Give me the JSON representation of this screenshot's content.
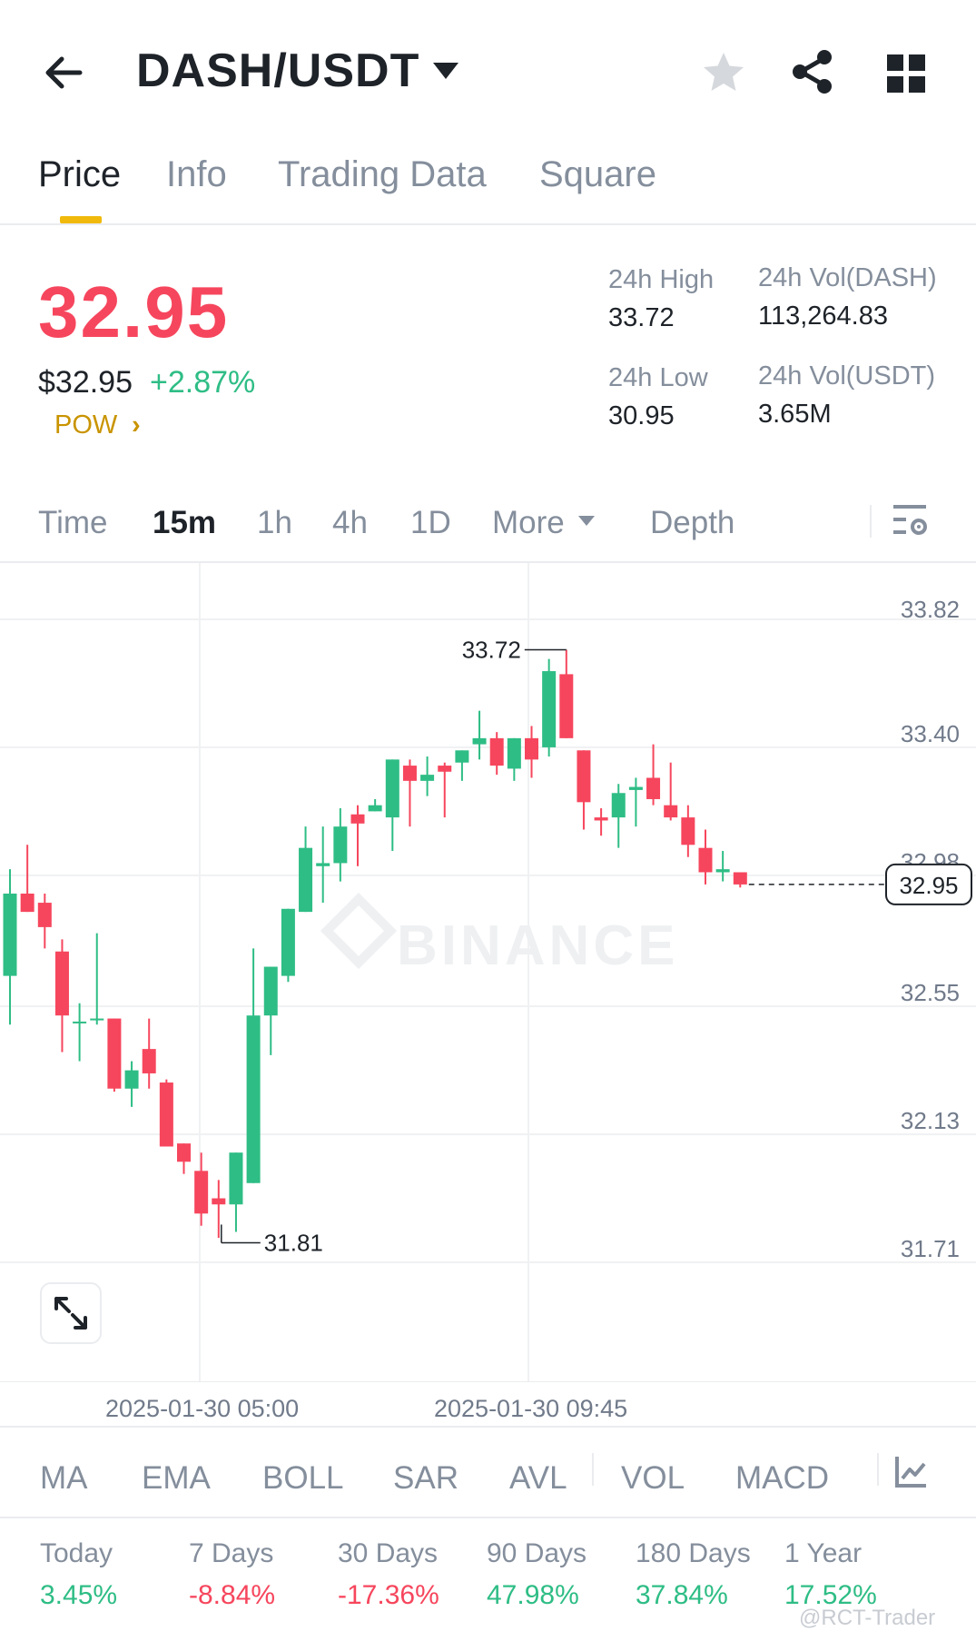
{
  "header": {
    "pair": "DASH/USDT",
    "icons": [
      "back-arrow-icon",
      "caret-down-icon",
      "star-icon",
      "share-icon",
      "grid-menu-icon"
    ]
  },
  "tabs": [
    {
      "label": "Price",
      "active": true
    },
    {
      "label": "Info",
      "active": false
    },
    {
      "label": "Trading Data",
      "active": false
    },
    {
      "label": "Square",
      "active": false
    }
  ],
  "price": {
    "last": "32.95",
    "usd": "$32.95",
    "change": "+2.87%",
    "tag": "POW",
    "tag_arrow": "›"
  },
  "stats": {
    "high_label": "24h High",
    "high_value": "33.72",
    "low_label": "24h Low",
    "low_value": "30.95",
    "vol_base_label": "24h Vol(DASH)",
    "vol_base_value": "113,264.83",
    "vol_quote_label": "24h Vol(USDT)",
    "vol_quote_value": "3.65M"
  },
  "intervals": {
    "time": "Time",
    "m15": "15m",
    "h1": "1h",
    "h4": "4h",
    "d1": "1D",
    "more": "More",
    "depth": "Depth",
    "active": "15m"
  },
  "colors": {
    "up": "#2ebd85",
    "down": "#f6465d",
    "accent": "#f0b90b",
    "text": "#1e2329",
    "muted": "#848e9c"
  },
  "chart_data": {
    "type": "candlestick",
    "ylim": [
      31.71,
      33.82
    ],
    "y_ticks": [
      "33.82",
      "33.40",
      "32.98",
      "32.55",
      "32.13",
      "31.71"
    ],
    "x_ticks": [
      "2025-01-30 05:00",
      "2025-01-30 09:45"
    ],
    "high_marker": "33.72",
    "low_marker": "31.81",
    "last_price": "32.95",
    "watermark": "BINANCE",
    "candles": [
      {
        "o": 32.65,
        "h": 33.0,
        "l": 32.49,
        "c": 32.92
      },
      {
        "o": 32.92,
        "h": 33.08,
        "l": 32.87,
        "c": 32.86
      },
      {
        "o": 32.89,
        "h": 32.92,
        "l": 32.74,
        "c": 32.81
      },
      {
        "o": 32.73,
        "h": 32.77,
        "l": 32.4,
        "c": 32.52
      },
      {
        "o": 32.5,
        "h": 32.56,
        "l": 32.37,
        "c": 32.5
      },
      {
        "o": 32.51,
        "h": 32.79,
        "l": 32.49,
        "c": 32.51
      },
      {
        "o": 32.51,
        "h": 32.51,
        "l": 32.27,
        "c": 32.28
      },
      {
        "o": 32.28,
        "h": 32.37,
        "l": 32.22,
        "c": 32.34
      },
      {
        "o": 32.41,
        "h": 32.51,
        "l": 32.28,
        "c": 32.33
      },
      {
        "o": 32.3,
        "h": 32.31,
        "l": 32.09,
        "c": 32.09
      },
      {
        "o": 32.1,
        "h": 32.08,
        "l": 32.0,
        "c": 32.04
      },
      {
        "o": 32.01,
        "h": 32.07,
        "l": 31.83,
        "c": 31.87
      },
      {
        "o": 31.92,
        "h": 31.98,
        "l": 31.79,
        "c": 31.9
      },
      {
        "o": 31.9,
        "h": 32.05,
        "l": 31.81,
        "c": 32.07
      },
      {
        "o": 31.97,
        "h": 32.74,
        "l": 31.97,
        "c": 32.52
      },
      {
        "o": 32.52,
        "h": 32.64,
        "l": 32.39,
        "c": 32.68
      },
      {
        "o": 32.65,
        "h": 32.87,
        "l": 32.63,
        "c": 32.87
      },
      {
        "o": 32.86,
        "h": 33.14,
        "l": 32.86,
        "c": 33.07
      },
      {
        "o": 33.01,
        "h": 33.14,
        "l": 32.89,
        "c": 33.02
      },
      {
        "o": 33.02,
        "h": 33.2,
        "l": 32.96,
        "c": 33.14
      },
      {
        "o": 33.18,
        "h": 33.21,
        "l": 33.01,
        "c": 33.15
      },
      {
        "o": 33.19,
        "h": 33.23,
        "l": 33.2,
        "c": 33.21
      },
      {
        "o": 33.17,
        "h": 33.32,
        "l": 33.06,
        "c": 33.36
      },
      {
        "o": 33.34,
        "h": 33.36,
        "l": 33.14,
        "c": 33.29
      },
      {
        "o": 33.29,
        "h": 33.37,
        "l": 33.24,
        "c": 33.31
      },
      {
        "o": 33.34,
        "h": 33.35,
        "l": 33.17,
        "c": 33.32
      },
      {
        "o": 33.35,
        "h": 33.36,
        "l": 33.29,
        "c": 33.39
      },
      {
        "o": 33.41,
        "h": 33.52,
        "l": 33.36,
        "c": 33.43
      },
      {
        "o": 33.43,
        "h": 33.45,
        "l": 33.31,
        "c": 33.34
      },
      {
        "o": 33.33,
        "h": 33.42,
        "l": 33.29,
        "c": 33.43
      },
      {
        "o": 33.43,
        "h": 33.47,
        "l": 33.3,
        "c": 33.36
      },
      {
        "o": 33.4,
        "h": 33.69,
        "l": 33.37,
        "c": 33.65
      },
      {
        "o": 33.64,
        "h": 33.72,
        "l": 33.43,
        "c": 33.43
      },
      {
        "o": 33.39,
        "h": 33.39,
        "l": 33.13,
        "c": 33.22
      },
      {
        "o": 33.17,
        "h": 33.2,
        "l": 33.11,
        "c": 33.16
      },
      {
        "o": 33.17,
        "h": 33.28,
        "l": 33.07,
        "c": 33.25
      },
      {
        "o": 33.26,
        "h": 33.3,
        "l": 33.14,
        "c": 33.27
      },
      {
        "o": 33.3,
        "h": 33.41,
        "l": 33.21,
        "c": 33.23
      },
      {
        "o": 33.21,
        "h": 33.35,
        "l": 33.16,
        "c": 33.17
      },
      {
        "o": 33.17,
        "h": 33.21,
        "l": 33.04,
        "c": 33.08
      },
      {
        "o": 33.07,
        "h": 33.13,
        "l": 32.95,
        "c": 32.99
      },
      {
        "o": 32.99,
        "h": 33.06,
        "l": 32.96,
        "c": 33.0
      },
      {
        "o": 32.99,
        "h": 32.99,
        "l": 32.94,
        "c": 32.95
      }
    ]
  },
  "time_axis": {
    "t1": "2025-01-30 05:00",
    "t2": "2025-01-30 09:45"
  },
  "indicators": [
    "MA",
    "EMA",
    "BOLL",
    "SAR",
    "AVL",
    "VOL",
    "MACD"
  ],
  "performance": [
    {
      "label": "Today",
      "value": "3.45%",
      "direction": "up"
    },
    {
      "label": "7 Days",
      "value": "-8.84%",
      "direction": "down"
    },
    {
      "label": "30 Days",
      "value": "-17.36%",
      "direction": "down"
    },
    {
      "label": "90 Days",
      "value": "47.98%",
      "direction": "up"
    },
    {
      "label": "180 Days",
      "value": "37.84%",
      "direction": "up"
    },
    {
      "label": "1 Year",
      "value": "17.52%",
      "direction": "up"
    }
  ],
  "watermark_credit": "@RCT-Trader"
}
